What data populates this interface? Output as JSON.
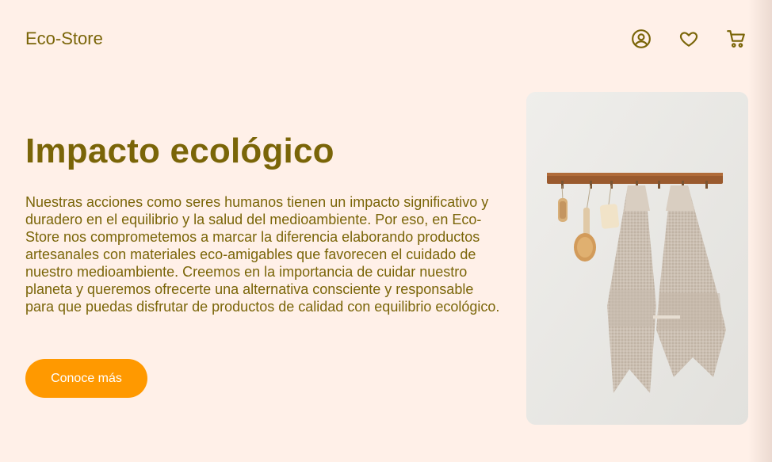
{
  "header": {
    "brand": "Eco-Store",
    "icons": [
      "user-circle-icon",
      "heart-icon",
      "cart-icon"
    ]
  },
  "hero": {
    "title": "Impacto ecológico",
    "body": "Nuestras acciones como seres humanos tienen un impacto significativo y duradero en el equilibrio y la salud del medioambiente. Por eso, en Eco-Store nos comprometemos a marcar la diferencia elaborando productos artesanales con materiales eco-amigables que favorecen el cuidado de nuestro medioambiente. Creemos en la importancia de cuidar nuestro planeta y queremos ofrecerte una alternativa consciente y responsable para que puedas disfrutar de productos de calidad con equilibrio ecológico.",
    "cta_label": "Conoce más",
    "image_subject": "towels and natural brushes hanging on a wooden hook rack"
  },
  "colors": {
    "background": "#fff0e8",
    "text": "#7a6508",
    "accent": "#ff9900"
  }
}
